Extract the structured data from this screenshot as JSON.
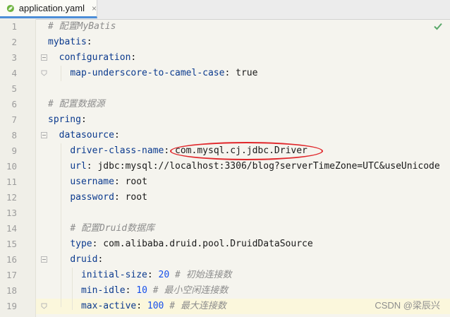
{
  "tab": {
    "filename": "application.yaml",
    "close": "×"
  },
  "line_numbers": [
    "1",
    "2",
    "3",
    "4",
    "5",
    "6",
    "7",
    "8",
    "9",
    "10",
    "11",
    "12",
    "13",
    "14",
    "15",
    "16",
    "17",
    "18",
    "19"
  ],
  "code": {
    "l1_comment": "# 配置MyBatis",
    "l2_key": "mybatis",
    "l3_key": "configuration",
    "l4_key": "map-underscore-to-camel-case",
    "l4_val": "true",
    "l6_comment": "# 配置数据源",
    "l7_key": "spring",
    "l8_key": "datasource",
    "l9_key": "driver-class-name",
    "l9_val": "com.mysql.cj.jdbc.Driver",
    "l10_key": "url",
    "l10_val": "jdbc:mysql://localhost:3306/blog?serverTimeZone=UTC&useUnicode",
    "l11_key": "username",
    "l11_val": "root",
    "l12_key": "password",
    "l12_val": "root",
    "l14_comment": "# 配置Druid数据库",
    "l15_key": "type",
    "l15_val": "com.alibaba.druid.pool.DruidDataSource",
    "l16_key": "druid",
    "l17_key": "initial-size",
    "l17_val": "20",
    "l17_comment": "# 初始连接数",
    "l18_key": "min-idle",
    "l18_val": "10",
    "l18_comment": "# 最小空闲连接数",
    "l19_key": "max-active",
    "l19_val": "100",
    "l19_comment": "# 最大连接数"
  },
  "watermark": "CSDN @梁辰兴",
  "colors": {
    "highlight_ellipse": "#e0262a",
    "tab_underline": "#4c8ed8",
    "check": "#59a869"
  },
  "icons": {
    "tab_file": "spring-leaf-icon",
    "inspection": "check-icon"
  }
}
